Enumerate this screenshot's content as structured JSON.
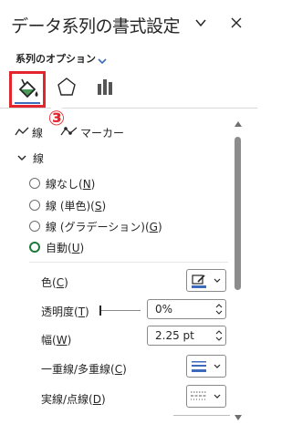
{
  "header": {
    "title": "データ系列の書式設定",
    "chevron_icon": "chevron-down-icon",
    "close_icon": "close-icon"
  },
  "series_options": {
    "label": "系列のオプション",
    "chevron_icon": "chevron-down-icon"
  },
  "tabs": [
    {
      "name": "fill-line",
      "icon": "paint-bucket-icon",
      "selected": true
    },
    {
      "name": "effects",
      "icon": "pentagon-icon",
      "selected": false
    },
    {
      "name": "series-options",
      "icon": "bar-chart-icon",
      "selected": false
    }
  ],
  "step_marker": "③",
  "subtabs": {
    "line": "線",
    "marker": "マーカー"
  },
  "line_section": {
    "title": "線"
  },
  "radio_options": [
    {
      "label_pre": "線なし(",
      "key": "N",
      "label_post": ")",
      "checked": false
    },
    {
      "label_pre": "線 (単色)(",
      "key": "S",
      "label_post": ")",
      "checked": false
    },
    {
      "label_pre": "線 (グラデーション)(",
      "key": "G",
      "label_post": ")",
      "checked": false
    },
    {
      "label_pre": "自動(",
      "key": "U",
      "label_post": ")",
      "checked": true
    }
  ],
  "properties": {
    "color": {
      "pre": "色(",
      "key": "C",
      "post": ")"
    },
    "transparency": {
      "pre": "透明度(",
      "key": "T",
      "post": ")",
      "value": "0%"
    },
    "width": {
      "pre": "幅(",
      "key": "W",
      "post": ")",
      "value": "2.25 pt"
    },
    "compound": {
      "pre": "一重線/多重線(",
      "key": "C",
      "post": ")"
    },
    "dash": {
      "pre": "実線/点線(",
      "key": "D",
      "post": ")"
    }
  },
  "colors": {
    "accent_red": "#e3262e",
    "accent_blue": "#3c6bbb",
    "radio_green": "#1f7a3a"
  },
  "transparency_level": 0
}
